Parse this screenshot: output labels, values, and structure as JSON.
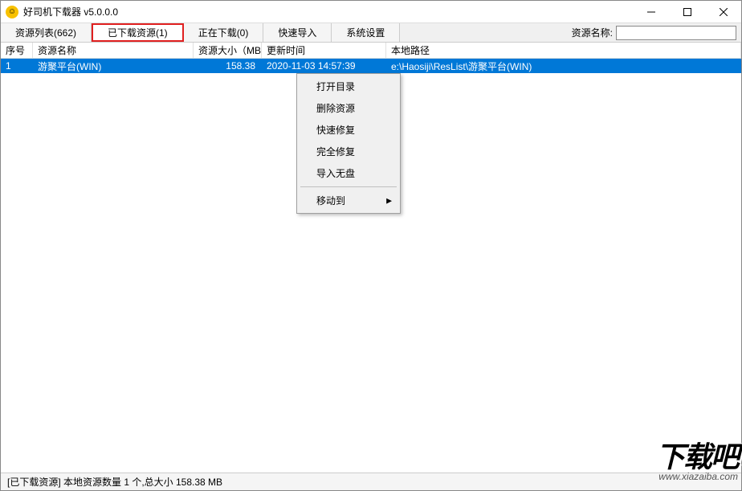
{
  "window": {
    "title": "好司机下载器 v5.0.0.0"
  },
  "tabs": [
    {
      "label": "资源列表(662)"
    },
    {
      "label": "已下载资源(1)"
    },
    {
      "label": "正在下载(0)"
    },
    {
      "label": "快速导入"
    },
    {
      "label": "系统设置"
    }
  ],
  "search": {
    "label": "资源名称:",
    "value": ""
  },
  "table": {
    "headers": {
      "idx": "序号",
      "name": "资源名称",
      "size": "资源大小（MB)",
      "time": "更新时间",
      "path": "本地路径"
    },
    "rows": [
      {
        "idx": "1",
        "name": "游聚平台(WIN)",
        "size": "158.38",
        "time": "2020-11-03  14:57:39",
        "path": "e:\\Haosiji\\ResList\\游聚平台(WIN)"
      }
    ]
  },
  "context_menu": {
    "items": [
      {
        "label": "打开目录"
      },
      {
        "label": "删除资源"
      },
      {
        "label": "快速修复"
      },
      {
        "label": "完全修复"
      },
      {
        "label": "导入无盘"
      }
    ],
    "submenu": {
      "label": "移动到"
    }
  },
  "statusbar": {
    "text": "[已下载资源] 本地资源数量 1 个,总大小 158.38 MB"
  },
  "watermark": {
    "big": "下载吧",
    "url": "www.xiazaiba.com"
  }
}
